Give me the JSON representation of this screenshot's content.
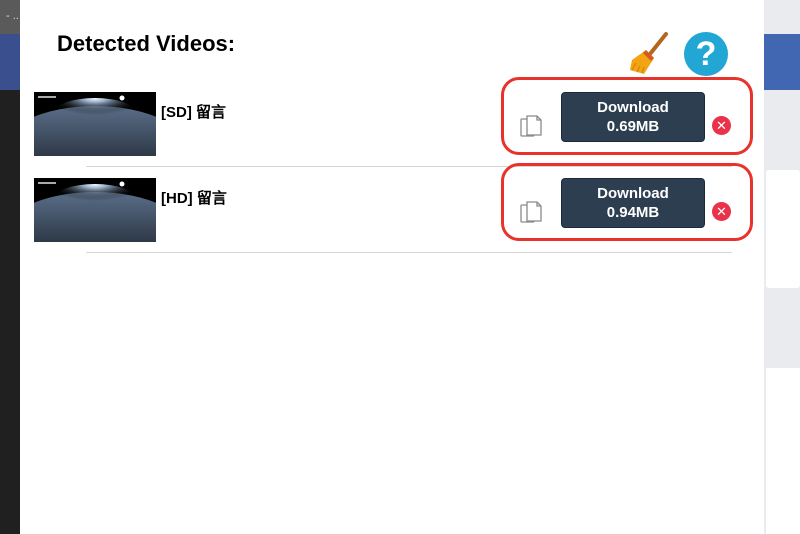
{
  "background": {
    "top_bar_text": "- .."
  },
  "popup": {
    "title": "Detected Videos:",
    "clear_icon": "broom-icon",
    "help_icon": "help-icon",
    "help_glyph": "?"
  },
  "videos": [
    {
      "label": "[SD] 留言",
      "button_line1": "Download",
      "button_line2": "0.69MB",
      "remove_glyph": "✕"
    },
    {
      "label": "[HD] 留言",
      "button_line1": "Download",
      "button_line2": "0.94MB",
      "remove_glyph": "✕"
    }
  ],
  "colors": {
    "button_bg": "#2c3e50",
    "highlight": "#e8322c",
    "help_bg": "#22a6d4",
    "remove_bg": "#e8334a"
  }
}
